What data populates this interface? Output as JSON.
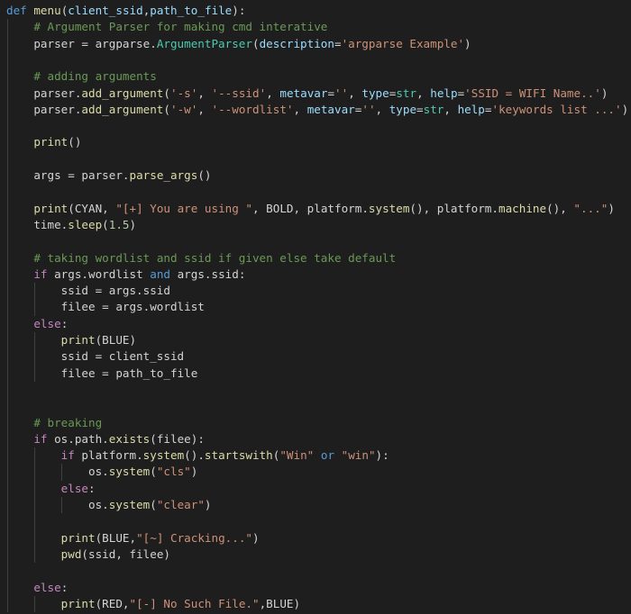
{
  "palette": {
    "keyword": "#569cd6",
    "control": "#c586c0",
    "function": "#dcdcaa",
    "parameter": "#9cdcfe",
    "string": "#ce9178",
    "comment": "#6a9955",
    "number": "#b5cea8",
    "builtin_type": "#4ec9b0",
    "default": "#d4d4d4",
    "background": "#1e1e1e"
  },
  "code_lines": [
    [
      [
        "keyword",
        "def"
      ],
      [
        "default",
        " "
      ],
      [
        "function",
        "menu"
      ],
      [
        "default",
        "("
      ],
      [
        "parameter",
        "client_ssid"
      ],
      [
        "default",
        ","
      ],
      [
        "parameter",
        "path_to_file"
      ],
      [
        "default",
        "):"
      ]
    ],
    [
      [
        "default",
        "    "
      ],
      [
        "comment",
        "# Argument Parser for making cmd interative"
      ]
    ],
    [
      [
        "default",
        "    parser = argparse."
      ],
      [
        "builtin_type",
        "ArgumentParser"
      ],
      [
        "default",
        "("
      ],
      [
        "parameter",
        "description"
      ],
      [
        "default",
        "="
      ],
      [
        "string",
        "'argparse Example'"
      ],
      [
        "default",
        ")"
      ]
    ],
    [],
    [
      [
        "default",
        "    "
      ],
      [
        "comment",
        "# adding arguments"
      ]
    ],
    [
      [
        "default",
        "    parser."
      ],
      [
        "function",
        "add_argument"
      ],
      [
        "default",
        "("
      ],
      [
        "string",
        "'-s'"
      ],
      [
        "default",
        ", "
      ],
      [
        "string",
        "'--ssid'"
      ],
      [
        "default",
        ", "
      ],
      [
        "parameter",
        "metavar"
      ],
      [
        "default",
        "="
      ],
      [
        "string",
        "''"
      ],
      [
        "default",
        ", "
      ],
      [
        "parameter",
        "type"
      ],
      [
        "default",
        "="
      ],
      [
        "builtin_type",
        "str"
      ],
      [
        "default",
        ", "
      ],
      [
        "parameter",
        "help"
      ],
      [
        "default",
        "="
      ],
      [
        "string",
        "'SSID = WIFI Name..'"
      ],
      [
        "default",
        ")"
      ]
    ],
    [
      [
        "default",
        "    parser."
      ],
      [
        "function",
        "add_argument"
      ],
      [
        "default",
        "("
      ],
      [
        "string",
        "'-w'"
      ],
      [
        "default",
        ", "
      ],
      [
        "string",
        "'--wordlist'"
      ],
      [
        "default",
        ", "
      ],
      [
        "parameter",
        "metavar"
      ],
      [
        "default",
        "="
      ],
      [
        "string",
        "''"
      ],
      [
        "default",
        ", "
      ],
      [
        "parameter",
        "type"
      ],
      [
        "default",
        "="
      ],
      [
        "builtin_type",
        "str"
      ],
      [
        "default",
        ", "
      ],
      [
        "parameter",
        "help"
      ],
      [
        "default",
        "="
      ],
      [
        "string",
        "'keywords list ...'"
      ],
      [
        "default",
        ")"
      ]
    ],
    [],
    [
      [
        "default",
        "    "
      ],
      [
        "function",
        "print"
      ],
      [
        "default",
        "()"
      ]
    ],
    [],
    [
      [
        "default",
        "    args = parser."
      ],
      [
        "function",
        "parse_args"
      ],
      [
        "default",
        "()"
      ]
    ],
    [],
    [
      [
        "default",
        "    "
      ],
      [
        "function",
        "print"
      ],
      [
        "default",
        "(CYAN, "
      ],
      [
        "string",
        "\"[+] You are using \""
      ],
      [
        "default",
        ", BOLD, platform."
      ],
      [
        "function",
        "system"
      ],
      [
        "default",
        "(), platform."
      ],
      [
        "function",
        "machine"
      ],
      [
        "default",
        "(), "
      ],
      [
        "string",
        "\"...\""
      ],
      [
        "default",
        ")"
      ]
    ],
    [
      [
        "default",
        "    time."
      ],
      [
        "function",
        "sleep"
      ],
      [
        "default",
        "("
      ],
      [
        "number",
        "1.5"
      ],
      [
        "default",
        ")"
      ]
    ],
    [],
    [
      [
        "default",
        "    "
      ],
      [
        "comment",
        "# taking wordlist and ssid if given else take default"
      ]
    ],
    [
      [
        "default",
        "    "
      ],
      [
        "control",
        "if"
      ],
      [
        "default",
        " args.wordlist "
      ],
      [
        "keyword",
        "and"
      ],
      [
        "default",
        " args.ssid:"
      ]
    ],
    [
      [
        "default",
        "        ssid = args.ssid"
      ]
    ],
    [
      [
        "default",
        "        filee = args.wordlist"
      ]
    ],
    [
      [
        "default",
        "    "
      ],
      [
        "control",
        "else"
      ],
      [
        "default",
        ":"
      ]
    ],
    [
      [
        "default",
        "        "
      ],
      [
        "function",
        "print"
      ],
      [
        "default",
        "(BLUE)"
      ]
    ],
    [
      [
        "default",
        "        ssid = client_ssid"
      ]
    ],
    [
      [
        "default",
        "        filee = path_to_file"
      ]
    ],
    [],
    [],
    [
      [
        "default",
        "    "
      ],
      [
        "comment",
        "# breaking"
      ]
    ],
    [
      [
        "default",
        "    "
      ],
      [
        "control",
        "if"
      ],
      [
        "default",
        " os.path."
      ],
      [
        "function",
        "exists"
      ],
      [
        "default",
        "(filee):"
      ]
    ],
    [
      [
        "default",
        "        "
      ],
      [
        "control",
        "if"
      ],
      [
        "default",
        " platform."
      ],
      [
        "function",
        "system"
      ],
      [
        "default",
        "()."
      ],
      [
        "function",
        "startswith"
      ],
      [
        "default",
        "("
      ],
      [
        "string",
        "\"Win\""
      ],
      [
        "default",
        " "
      ],
      [
        "keyword",
        "or"
      ],
      [
        "default",
        " "
      ],
      [
        "string",
        "\"win\""
      ],
      [
        "default",
        "):"
      ]
    ],
    [
      [
        "default",
        "            os."
      ],
      [
        "function",
        "system"
      ],
      [
        "default",
        "("
      ],
      [
        "string",
        "\"cls\""
      ],
      [
        "default",
        ")"
      ]
    ],
    [
      [
        "default",
        "        "
      ],
      [
        "control",
        "else"
      ],
      [
        "default",
        ":"
      ]
    ],
    [
      [
        "default",
        "            os."
      ],
      [
        "function",
        "system"
      ],
      [
        "default",
        "("
      ],
      [
        "string",
        "\"clear\""
      ],
      [
        "default",
        ")"
      ]
    ],
    [],
    [
      [
        "default",
        "        "
      ],
      [
        "function",
        "print"
      ],
      [
        "default",
        "(BLUE,"
      ],
      [
        "string",
        "\"[~] Cracking...\""
      ],
      [
        "default",
        ")"
      ]
    ],
    [
      [
        "default",
        "        "
      ],
      [
        "function",
        "pwd"
      ],
      [
        "default",
        "(ssid, filee)"
      ]
    ],
    [],
    [
      [
        "default",
        "    "
      ],
      [
        "control",
        "else"
      ],
      [
        "default",
        ":"
      ]
    ],
    [
      [
        "default",
        "        "
      ],
      [
        "function",
        "print"
      ],
      [
        "default",
        "(RED,"
      ],
      [
        "string",
        "\"[-] No Such File.\""
      ],
      [
        "default",
        ",BLUE)"
      ]
    ]
  ]
}
